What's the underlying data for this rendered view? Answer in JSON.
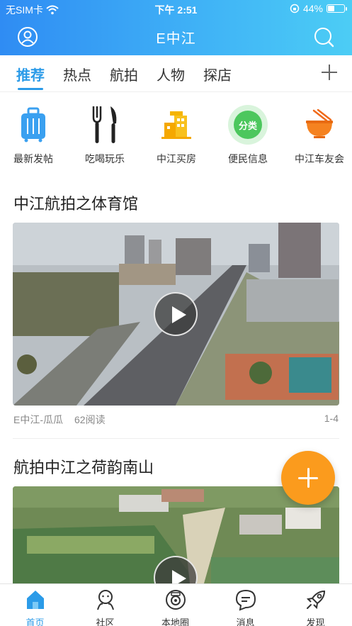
{
  "status": {
    "carrier": "无SIM卡",
    "time": "下午 2:51",
    "battery": "44%",
    "battery_level": 0.44
  },
  "header": {
    "title": "E中江",
    "left_icon": "user-icon",
    "right_icon": "search-icon"
  },
  "tabs": [
    "推荐",
    "热点",
    "航拍",
    "人物",
    "探店"
  ],
  "active_tab": 0,
  "quick": [
    {
      "label": "最新发帖",
      "icon": "suitcase-icon"
    },
    {
      "label": "吃喝玩乐",
      "icon": "fork-knife-icon"
    },
    {
      "label": "中江买房",
      "icon": "building-icon"
    },
    {
      "label": "便民信息",
      "icon": "category-icon",
      "badge": "分类"
    },
    {
      "label": "中江车友会",
      "icon": "bowl-icon"
    }
  ],
  "posts": [
    {
      "title": "中江航拍之体育馆",
      "author": "E中江-瓜瓜",
      "reads": "62阅读",
      "page": "1-4"
    },
    {
      "title": "航拍中江之荷韵南山"
    }
  ],
  "tabbar": [
    {
      "label": "首页",
      "icon": "home-icon",
      "active": true
    },
    {
      "label": "社区",
      "icon": "community-icon"
    },
    {
      "label": "本地圈",
      "icon": "local-circle-icon"
    },
    {
      "label": "消息",
      "icon": "message-icon"
    },
    {
      "label": "发现",
      "icon": "rocket-icon"
    }
  ],
  "colors": {
    "accent": "#2b9be8",
    "fab": "#fb9b1d"
  }
}
